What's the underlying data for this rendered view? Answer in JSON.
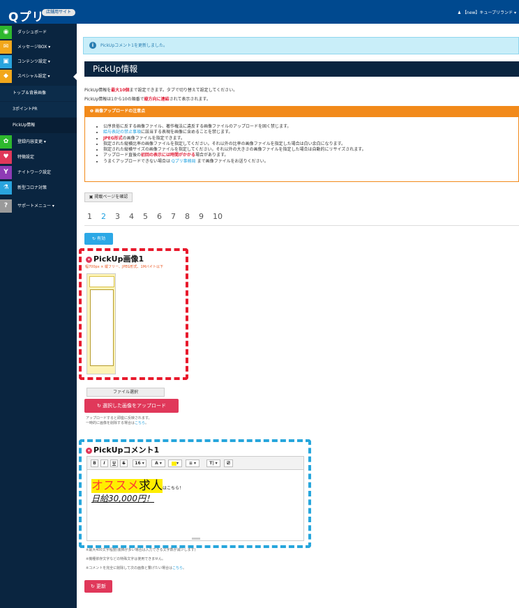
{
  "header": {
    "logo": "Qプリ",
    "badge": "店舗用サイト",
    "user": "【new】キュープリランド"
  },
  "sidebar": {
    "items": [
      {
        "label": "ダッシュボード",
        "icon": "dashboard-icon",
        "color": "#2eb82e",
        "glyph": "◉"
      },
      {
        "label": "メッセージBOX ▾",
        "icon": "envelope-icon",
        "color": "#f2a71b",
        "glyph": "✉"
      },
      {
        "label": "コンテンツ設定 ▾",
        "icon": "image-icon",
        "color": "#29a4dd",
        "glyph": "▣"
      },
      {
        "label": "スペシャル設定 ▾",
        "icon": "diamond-icon",
        "color": "#f2a71b",
        "glyph": "◆"
      }
    ],
    "subitems": [
      {
        "label": "トップ＆背景画像"
      },
      {
        "label": "3ポイントPR"
      },
      {
        "label": "PickUp情報"
      }
    ],
    "items2": [
      {
        "label": "登録内容変更 ▾",
        "icon": "gear-icon",
        "color": "#2eb82e",
        "glyph": "✿"
      },
      {
        "label": "特徴設定",
        "icon": "heart-icon",
        "color": "#e0385a",
        "glyph": "♥"
      },
      {
        "label": "ナイトワーク設定",
        "icon": "cocktail-icon",
        "color": "#8e3bb5",
        "glyph": "Y"
      },
      {
        "label": "新型コロナ対策",
        "icon": "flask-icon",
        "color": "#29a4dd",
        "glyph": "⚗"
      },
      {
        "label": "サポートメニュー ▾",
        "icon": "question-icon",
        "color": "#9a9a9a",
        "glyph": "?"
      }
    ]
  },
  "alert": {
    "text": "PickUpコメント1を更新しました。"
  },
  "page": {
    "title": "PickUp情報",
    "desc1_a": "PickUp情報を",
    "desc1_b": "最大10個",
    "desc1_c": "まで設定できます。タブで切り替えて設定してください。",
    "desc2_a": "PickUp情報は1から10の順番で",
    "desc2_b": "縦方向に連結",
    "desc2_c": "されて表示されます。"
  },
  "notice": {
    "title": "画像アップロードの注意点",
    "items": [
      {
        "a": "公序良俗に反する画像ファイル、著作権法に違反する画像ファイルのアップロードを固く禁じます。",
        "b": "",
        "c": ""
      },
      {
        "a": "",
        "b": "給与表記の禁止事項",
        "c": "に該当する表現を画像に含めることを禁じます。"
      },
      {
        "a": "",
        "b": "JPEG形式",
        "c": "の画像ファイルを指定できます。"
      },
      {
        "a": "指定された縦横比率の画像ファイルを指定してください。それ以外の比率の画像ファイルを指定した場合は白い余白になります。",
        "b": "",
        "c": ""
      },
      {
        "a": "指定された縦横サイズの画像ファイルを指定してください。それ以外の大きさの画像ファイルを指定した場合は自動的にリサイズされます。",
        "b": "",
        "c": ""
      },
      {
        "a": "アップロード直後の",
        "b": "初回の表示には時間がかかる",
        "c": "場合があります。"
      },
      {
        "a": "うまくアップロードできない場合は ",
        "b": "Qプリ事務局",
        "c": " まで画像ファイルをお送りください。"
      }
    ]
  },
  "preview_button": "掲載ページを確認",
  "pagination": [
    "1",
    "2",
    "3",
    "4",
    "5",
    "6",
    "7",
    "8",
    "9",
    "10"
  ],
  "enable_button": "有効",
  "image_section": {
    "title": "PickUp画像1",
    "hint": "幅700px × 縦フリー、JPEG形式、1Mバイト以下",
    "file_button": "ファイル選択",
    "upload_button": "選択した画像をアップロード",
    "note1": "アップロードすると即座に反映されます。",
    "note2_a": "一時的に画像を削除する場合は",
    "note2_b": "こちら",
    "note2_c": "。"
  },
  "comment_section": {
    "title": "PickUpコメント1",
    "toolbar": [
      "B",
      "I",
      "U",
      "S",
      "16 ▾",
      "A ▾",
      "▾",
      "≡ ▾",
      "T| ▾",
      "⎚"
    ],
    "line1_hl": "オススメ",
    "line1_big": "求人",
    "line1_small": "はこちら！",
    "line2": "日給30,000円！",
    "note1": "※最大400文字程度(装飾が多い場合は入力できる文字数が減少します)",
    "note2": "※機種依存文字などの特殊文字は使用できません。",
    "note3_a": "※コメントを完全に削除して次の画像と繋げたい場合は",
    "note3_b": "こちら",
    "note3_c": "。",
    "update_button": "更新"
  }
}
